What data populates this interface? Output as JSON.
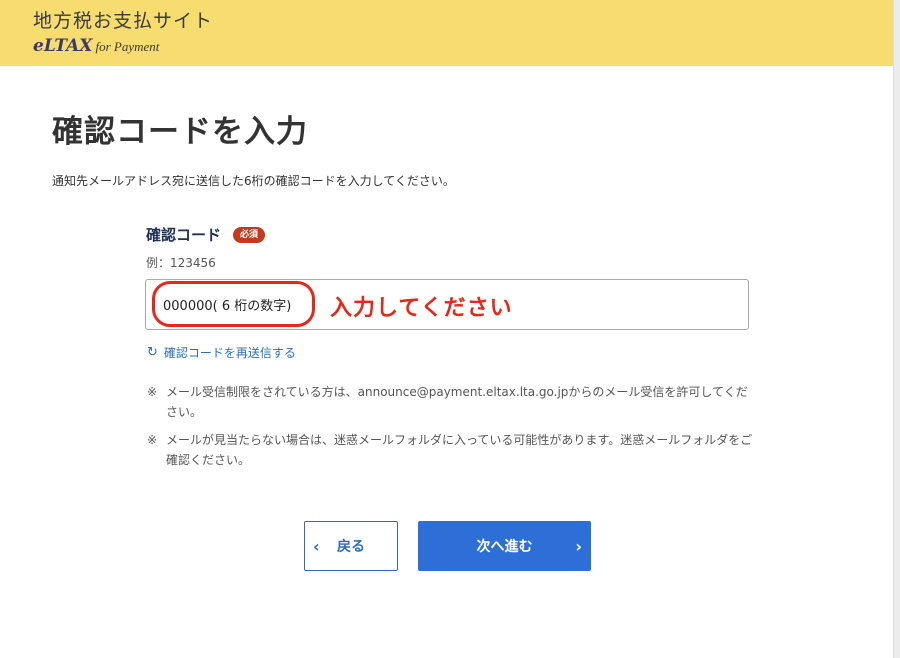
{
  "header": {
    "site_title": "地方税お支払サイト",
    "logo_brand": "eLTAX",
    "logo_sub": "for Payment",
    "background_color": "#f7dc6f"
  },
  "main": {
    "title": "確認コードを入力",
    "description": "通知先メールアドレス宛に送信した6桁の確認コードを入力してください。",
    "field": {
      "label": "確認コード",
      "required_badge": "必須",
      "example": "例：123456",
      "value": "000000( 6 桁の数字)",
      "placeholder": ""
    },
    "annotation": {
      "text": "入力してください",
      "color": "#e8261a"
    },
    "resend_link": {
      "icon": "refresh-icon",
      "label": "確認コードを再送信する"
    },
    "notes": [
      {
        "mark": "※",
        "text": "メール受信制限をされている方は、announce@payment.eltax.lta.go.jpからのメール受信を許可してください。"
      },
      {
        "mark": "※",
        "text": "メールが見当たらない場合は、迷惑メールフォルダに入っている可能性があります。迷惑メールフォルダをご確認ください。"
      }
    ]
  },
  "buttons": {
    "back_label": "戻る",
    "back_icon": "chevron-left-icon",
    "next_label": "次へ進む",
    "next_icon": "chevron-right-icon",
    "accent_color": "#2d6fd6"
  }
}
